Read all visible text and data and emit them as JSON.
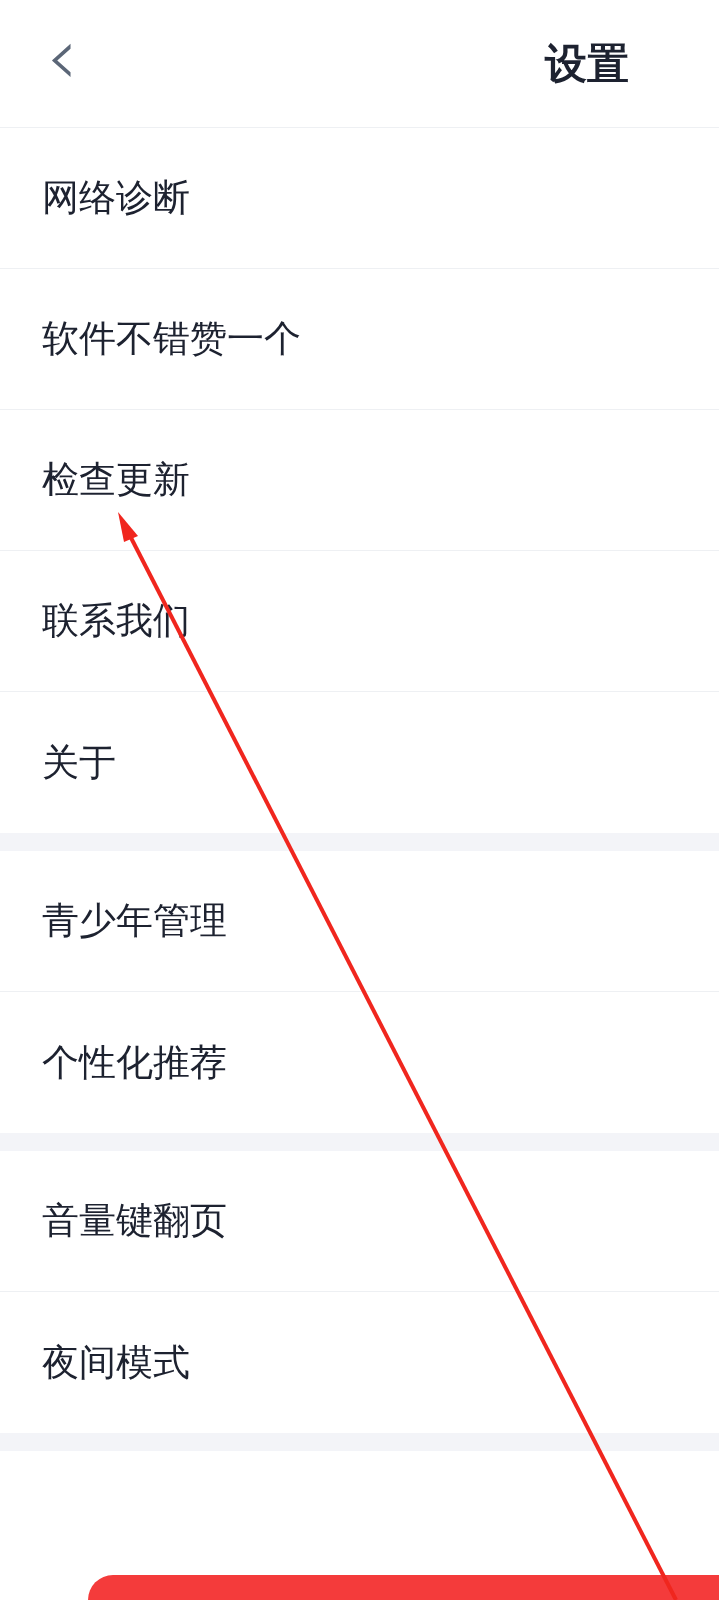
{
  "header": {
    "back": "‹",
    "title": "设置"
  },
  "groups": [
    {
      "items": [
        {
          "label": "网络诊断"
        },
        {
          "label": "软件不错赞一个"
        },
        {
          "label": "检查更新"
        },
        {
          "label": "联系我们"
        },
        {
          "label": "关于"
        }
      ]
    },
    {
      "items": [
        {
          "label": "青少年管理"
        },
        {
          "label": "个性化推荐"
        }
      ]
    },
    {
      "items": [
        {
          "label": "音量键翻页"
        },
        {
          "label": "夜间模式"
        }
      ]
    }
  ]
}
